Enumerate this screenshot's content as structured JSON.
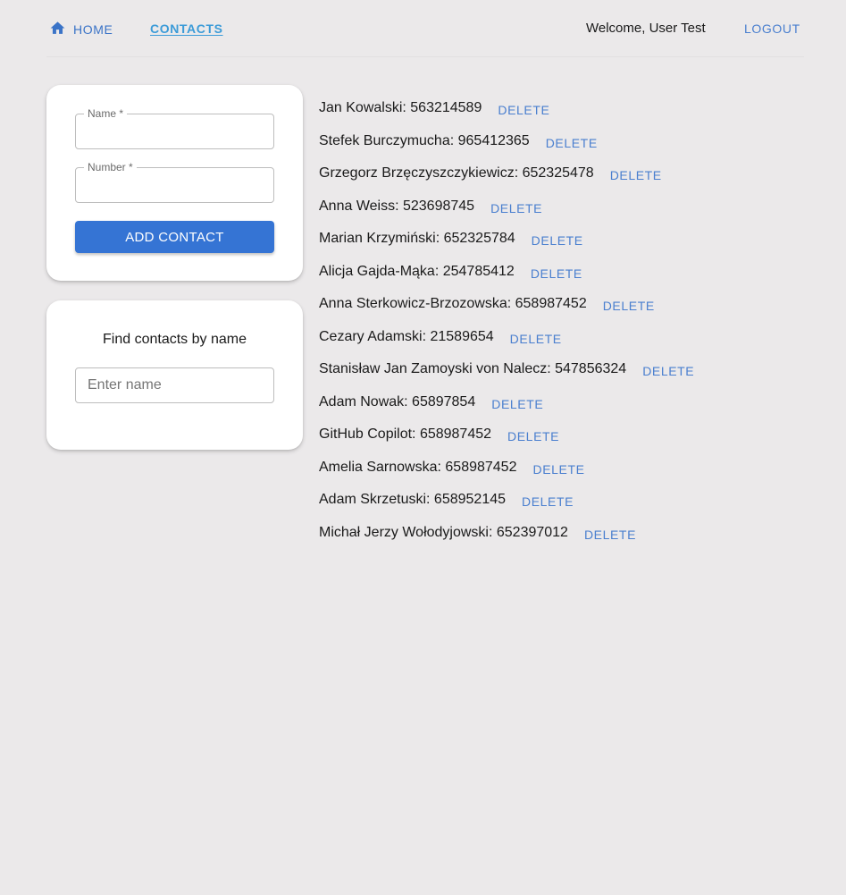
{
  "nav": {
    "home_label": "HOME",
    "contacts_label": "CONTACTS",
    "welcome_text": "Welcome, User Test",
    "logout_label": "LOGOUT",
    "home_icon": "home-icon"
  },
  "form": {
    "name_label": "Name *",
    "name_value": "",
    "number_label": "Number *",
    "number_value": "",
    "add_label": "ADD CONTACT"
  },
  "filter": {
    "title": "Find contacts by name",
    "placeholder": "Enter name",
    "value": ""
  },
  "contacts": [
    {
      "text": "Jan Kowalski: 563214589",
      "delete_label": "DELETE"
    },
    {
      "text": "Stefek Burczymucha: 965412365",
      "delete_label": "DELETE"
    },
    {
      "text": "Grzegorz Brzęczyszczykiewicz: 652325478",
      "delete_label": "DELETE"
    },
    {
      "text": "Anna Weiss: 523698745",
      "delete_label": "DELETE"
    },
    {
      "text": "Marian Krzymiński: 652325784",
      "delete_label": "DELETE"
    },
    {
      "text": "Alicja Gajda-Mąka: 254785412",
      "delete_label": "DELETE"
    },
    {
      "text": "Anna Sterkowicz-Brzozowska: 658987452",
      "delete_label": "DELETE"
    },
    {
      "text": "Cezary Adamski: 21589654",
      "delete_label": "DELETE"
    },
    {
      "text": "Stanisław Jan Zamoyski von Nalecz: 547856324",
      "delete_label": "DELETE"
    },
    {
      "text": "Adam Nowak: 65897854",
      "delete_label": "DELETE"
    },
    {
      "text": "GitHub Copilot: 658987452",
      "delete_label": "DELETE"
    },
    {
      "text": "Amelia Sarnowska: 658987452",
      "delete_label": "DELETE"
    },
    {
      "text": "Adam Skrzetuski: 658952145",
      "delete_label": "DELETE"
    },
    {
      "text": "Michał Jerzy Wołodyjowski: 652397012",
      "delete_label": "DELETE"
    }
  ],
  "colors": {
    "background": "#ebe9ea",
    "accent": "#3574d4",
    "link": "#4a7fcf",
    "active_link": "#3b9bd8"
  }
}
